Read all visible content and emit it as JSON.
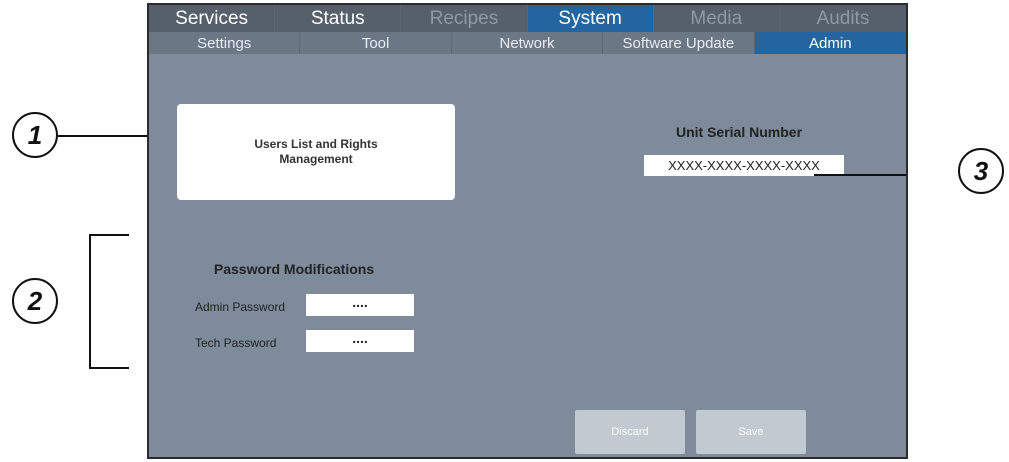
{
  "main_tabs": [
    "Services",
    "Status",
    "Recipes",
    "System",
    "Media",
    "Audits"
  ],
  "sub_tabs": [
    "Settings",
    "Tool",
    "Network",
    "Software Update",
    "Admin"
  ],
  "users_button_label": "Users List and Rights Management",
  "serial": {
    "title": "Unit Serial Number",
    "value": "XXXX-XXXX-XXXX-XXXX"
  },
  "password": {
    "title": "Password Modifications",
    "admin_label": "Admin Password",
    "admin_value": "....",
    "tech_label": "Tech Password",
    "tech_value": "...."
  },
  "buttons": {
    "discard": "Discard",
    "save": "Save"
  },
  "callouts": [
    "1",
    "2",
    "3"
  ],
  "colors": {
    "panel": "#7d8b9a",
    "active_tab": "#22659f",
    "tab_bar": "#56606c"
  }
}
